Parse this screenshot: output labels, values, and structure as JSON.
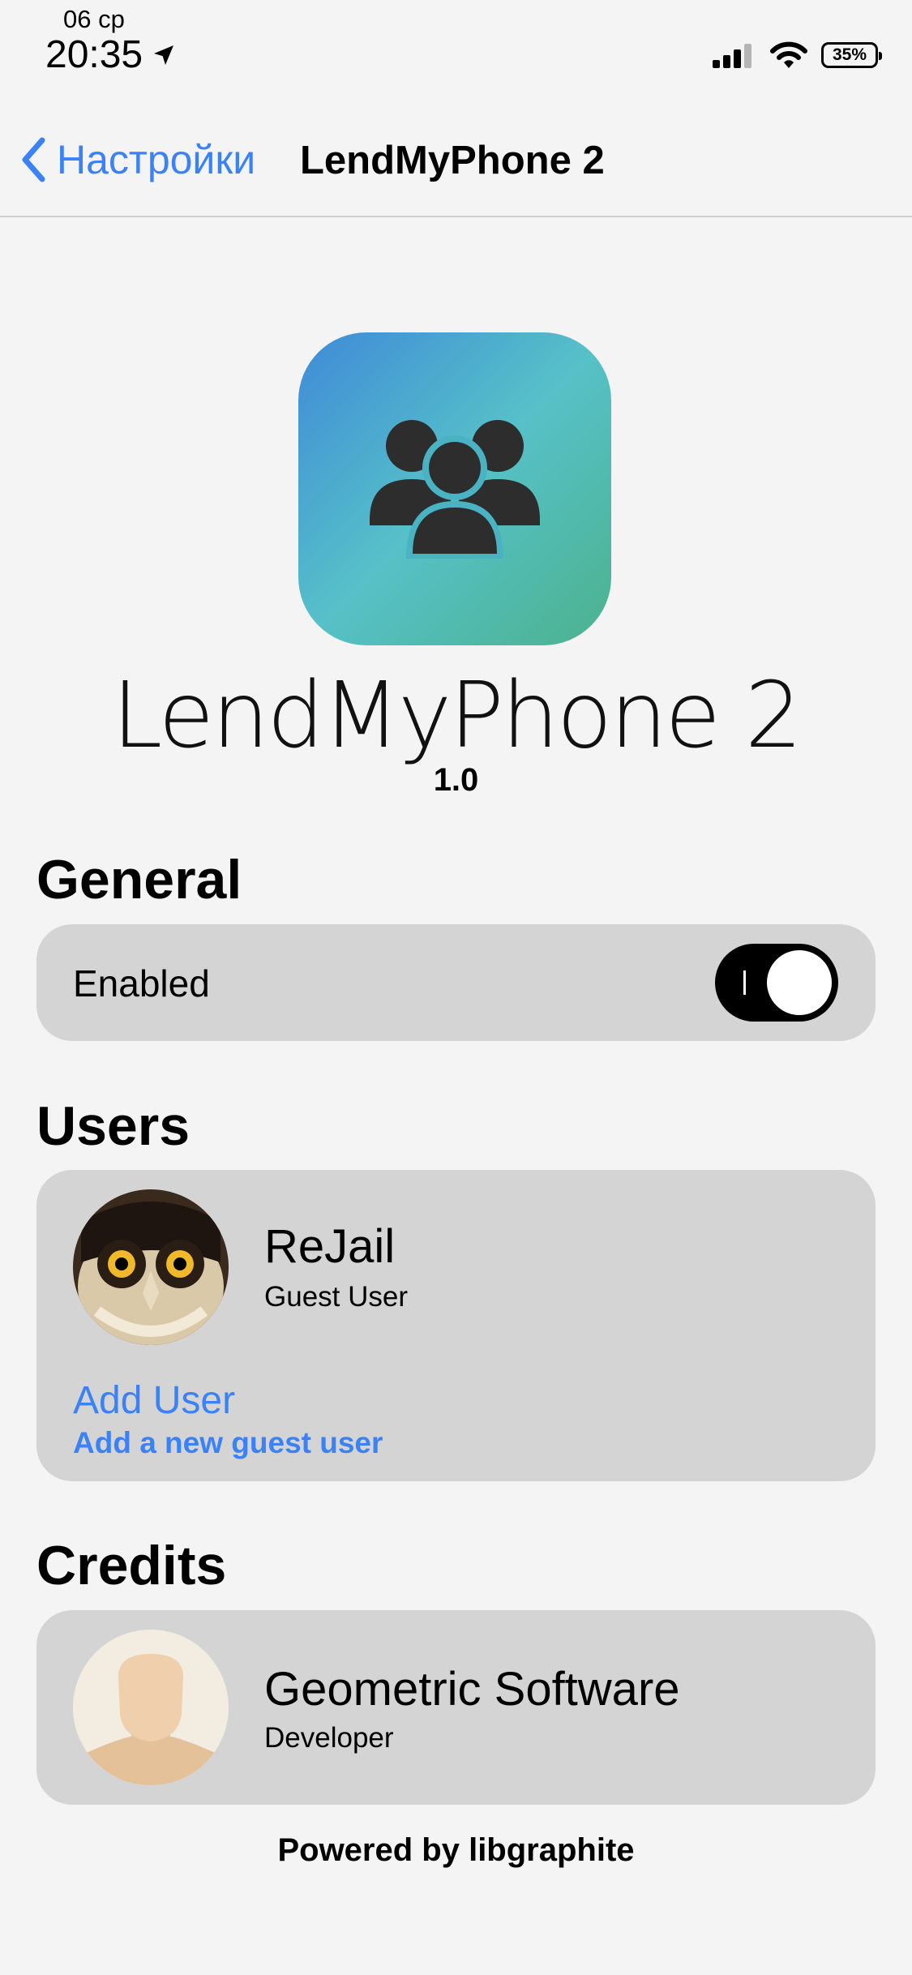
{
  "status_bar": {
    "date": "06 ср",
    "time": "20:35",
    "battery": "35%"
  },
  "nav": {
    "back_label": "Настройки",
    "title": "LendMyPhone 2"
  },
  "header": {
    "app_name": "LendMyPhone 2",
    "version": "1.0"
  },
  "general": {
    "title": "General",
    "enabled_label": "Enabled",
    "enabled": true
  },
  "users": {
    "title": "Users",
    "items": [
      {
        "name": "ReJail",
        "role": "Guest User"
      }
    ],
    "add_label": "Add User",
    "add_sub": "Add a new guest user"
  },
  "credits": {
    "title": "Credits",
    "items": [
      {
        "name": "Geometric Software",
        "role": "Developer"
      }
    ]
  },
  "footer": "Powered by libgraphite",
  "colors": {
    "accent": "#3b82f6",
    "card": "#d4d4d4",
    "background": "#f4f4f4"
  }
}
